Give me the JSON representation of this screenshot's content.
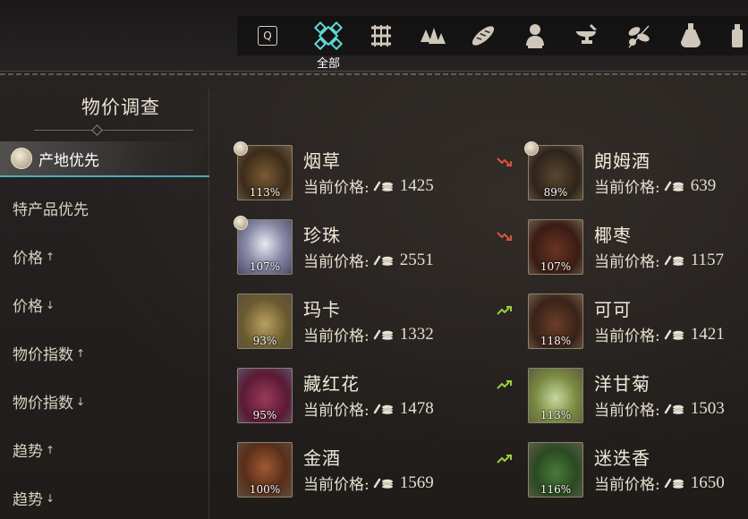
{
  "topbar": {
    "key_hint": "Q",
    "categories": [
      {
        "icon": "all-goods-icon",
        "label": "全部",
        "active": true
      },
      {
        "icon": "textile-icon"
      },
      {
        "icon": "minerals-icon"
      },
      {
        "icon": "bread-icon"
      },
      {
        "icon": "bust-statue-icon"
      },
      {
        "icon": "anvil-icon"
      },
      {
        "icon": "herbs-icon"
      },
      {
        "icon": "potion-icon"
      },
      {
        "icon": "bottle-icon"
      }
    ]
  },
  "sidebar": {
    "title": "物价调查",
    "sort_options": [
      {
        "label": "产地优先",
        "active": true
      },
      {
        "label": "特产品优先"
      },
      {
        "label": "价格",
        "arrow": "↑"
      },
      {
        "label": "价格",
        "arrow": "↓"
      },
      {
        "label": "物价指数",
        "arrow": "↑"
      },
      {
        "label": "物价指数",
        "arrow": "↓"
      },
      {
        "label": "趋势",
        "arrow": "↑"
      },
      {
        "label": "趋势",
        "arrow": "↓"
      }
    ]
  },
  "price_label": "当前价格:",
  "colors": {
    "trend_down": "#d9553f",
    "trend_up": "#9ccf3a",
    "accent": "#3fb0c0"
  },
  "items": [
    {
      "name": "烟草",
      "price": "1425",
      "index": "113%",
      "trend": "down",
      "origin": true,
      "thumb": "tobacco"
    },
    {
      "name": "朗姆酒",
      "price": "639",
      "index": "89%",
      "trend": "",
      "origin": true,
      "thumb": "rum"
    },
    {
      "name": "珍珠",
      "price": "2551",
      "index": "107%",
      "trend": "down",
      "origin": true,
      "thumb": "pearl"
    },
    {
      "name": "椰枣",
      "price": "1157",
      "index": "107%",
      "trend": "",
      "origin": false,
      "thumb": "dates"
    },
    {
      "name": "玛卡",
      "price": "1332",
      "index": "93%",
      "trend": "up",
      "origin": false,
      "thumb": "maca"
    },
    {
      "name": "可可",
      "price": "1421",
      "index": "118%",
      "trend": "",
      "origin": false,
      "thumb": "cocoa"
    },
    {
      "name": "藏红花",
      "price": "1478",
      "index": "95%",
      "trend": "up",
      "origin": false,
      "thumb": "saffron"
    },
    {
      "name": "洋甘菊",
      "price": "1503",
      "index": "113%",
      "trend": "",
      "origin": false,
      "thumb": "chamomile"
    },
    {
      "name": "金酒",
      "price": "1569",
      "index": "100%",
      "trend": "up",
      "origin": false,
      "thumb": "gin"
    },
    {
      "name": "迷迭香",
      "price": "1650",
      "index": "116%",
      "trend": "",
      "origin": false,
      "thumb": "rosemary"
    }
  ]
}
